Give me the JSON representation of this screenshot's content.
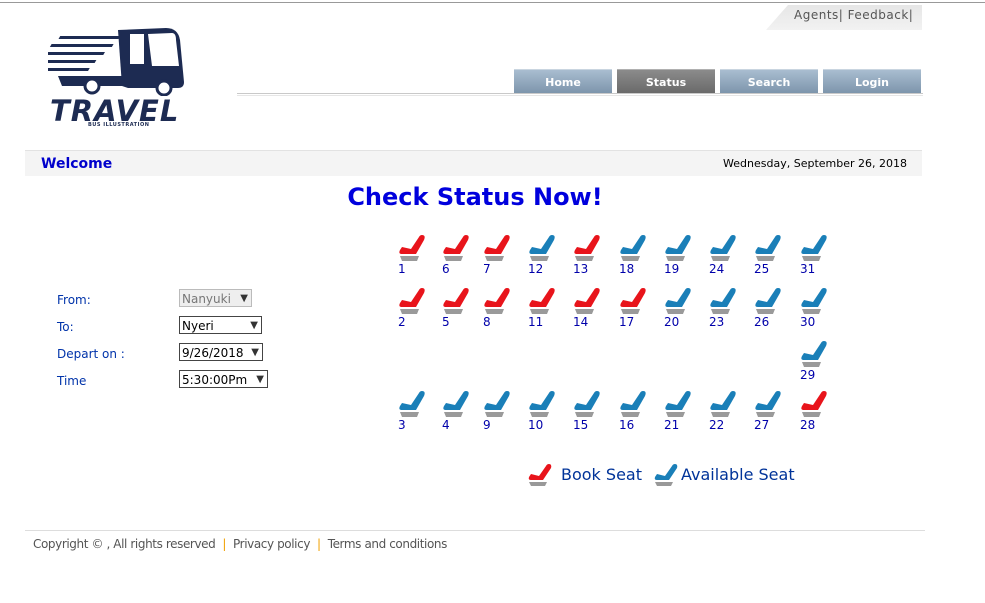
{
  "top_links": [
    "Agents",
    "Feedback"
  ],
  "logo": {
    "brand": "TRAVEL",
    "tagline": "BUS ILLUSTRATION"
  },
  "nav": [
    {
      "label": "Home",
      "active": false
    },
    {
      "label": "Status",
      "active": true
    },
    {
      "label": "Search",
      "active": false
    },
    {
      "label": "Login",
      "active": false
    }
  ],
  "welcome": "Welcome",
  "date": "Wednesday, September 26, 2018",
  "heading": "Check Status Now!",
  "form": {
    "from": {
      "label": "From:",
      "value": "Nanyuki",
      "disabled": true
    },
    "to": {
      "label": "To:",
      "value": "Nyeri"
    },
    "depart": {
      "label": "Depart on :",
      "value": "9/26/2018"
    },
    "time": {
      "label": "Time",
      "value": "5:30:00Pm"
    }
  },
  "colors": {
    "booked": "#e8141b",
    "available": "#1a7fb8",
    "accent": "#0000cc"
  },
  "seat_rows": [
    [
      {
        "n": "1",
        "booked": true
      },
      {
        "n": "6",
        "booked": true
      },
      {
        "n": "7",
        "booked": true
      },
      {
        "n": "12",
        "booked": false
      },
      {
        "n": "13",
        "booked": true
      },
      {
        "n": "18",
        "booked": false
      },
      {
        "n": "19",
        "booked": false
      },
      {
        "n": "24",
        "booked": false
      },
      {
        "n": "25",
        "booked": false
      },
      {
        "n": "31",
        "booked": false
      }
    ],
    [
      {
        "n": "2",
        "booked": true
      },
      {
        "n": "5",
        "booked": true
      },
      {
        "n": "8",
        "booked": true
      },
      {
        "n": "11",
        "booked": true
      },
      {
        "n": "14",
        "booked": true
      },
      {
        "n": "17",
        "booked": true
      },
      {
        "n": "20",
        "booked": false
      },
      {
        "n": "23",
        "booked": false
      },
      {
        "n": "26",
        "booked": false
      },
      {
        "n": "30",
        "booked": false
      }
    ],
    [
      {
        "n": "29",
        "booked": false
      }
    ],
    [
      {
        "n": "3",
        "booked": false
      },
      {
        "n": "4",
        "booked": false
      },
      {
        "n": "9",
        "booked": false
      },
      {
        "n": "10",
        "booked": false
      },
      {
        "n": "15",
        "booked": false
      },
      {
        "n": "16",
        "booked": false
      },
      {
        "n": "21",
        "booked": false
      },
      {
        "n": "22",
        "booked": false
      },
      {
        "n": "27",
        "booked": false
      },
      {
        "n": "28",
        "booked": true
      }
    ]
  ],
  "legend": {
    "booked": "Book Seat",
    "available": "Available Seat"
  },
  "footer": {
    "copyright": "Copyright © , All rights reserved",
    "privacy": "Privacy policy",
    "terms": "Terms and conditions"
  }
}
